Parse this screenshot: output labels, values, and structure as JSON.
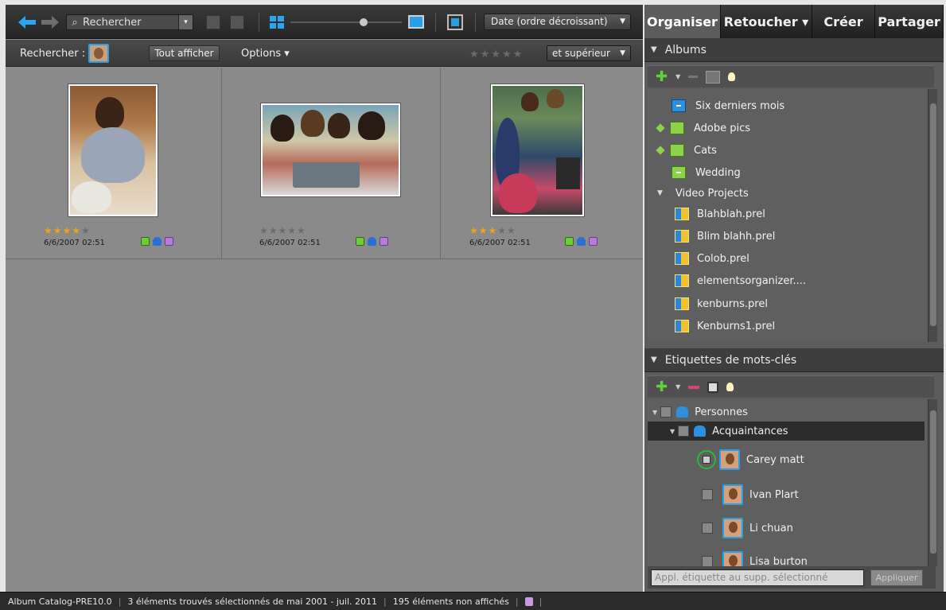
{
  "toolbar": {
    "search_placeholder": "Rechercher",
    "sort_value": "Date (ordre décroissant)"
  },
  "filterbar": {
    "search_label": "Rechercher :",
    "show_all": "Tout afficher",
    "options": "Options ▾",
    "rating_filter": "et supérieur"
  },
  "photos": [
    {
      "date": "6/6/2007 02:51",
      "rating": 4
    },
    {
      "date": "6/6/2007 02:51",
      "rating": 0
    },
    {
      "date": "6/6/2007 02:51",
      "rating": 3
    }
  ],
  "tabs": {
    "organize": "Organiser",
    "fix": "Retoucher ▾",
    "create": "Créer",
    "share": "Partager"
  },
  "albums": {
    "title": "Albums",
    "items": [
      {
        "label": "Six derniers mois",
        "icon": "album-blue-icon"
      },
      {
        "label": "Adobe pics",
        "icon": "smart-album-icon"
      },
      {
        "label": "Cats",
        "icon": "smart-album-icon"
      },
      {
        "label": "Wedding",
        "icon": "album-green-icon"
      },
      {
        "label": "Video Projects",
        "icon": "group-icon"
      },
      {
        "label": "Blahblah.prel",
        "icon": "premiere-project-icon"
      },
      {
        "label": "Blim blahh.prel",
        "icon": "premiere-project-icon"
      },
      {
        "label": "Colob.prel",
        "icon": "premiere-project-icon"
      },
      {
        "label": "elementsorganizer....",
        "icon": "premiere-project-icon"
      },
      {
        "label": "kenburns.prel",
        "icon": "premiere-project-icon"
      },
      {
        "label": "Kenburns1.prel",
        "icon": "premiere-project-icon"
      }
    ]
  },
  "keywords": {
    "title": "Etiquettes de mots-clés",
    "category": "Personnes",
    "subcategory": "Acquaintances",
    "people": [
      {
        "name": "Carey matt"
      },
      {
        "name": "Ivan Plart"
      },
      {
        "name": "Li chuan"
      },
      {
        "name": "Lisa burton"
      }
    ],
    "apply_placeholder": "Appl. étiquette au supp. sélectionné",
    "apply_button": "Appliquer"
  },
  "status": {
    "catalog": "Album Catalog-PRE10.0",
    "found": "3 éléments trouvés sélectionnés de mai 2001 - juil. 2011",
    "hidden": "195 éléments non affichés"
  },
  "colors": {
    "accent_blue": "#29a0e6",
    "star": "#f0a21a",
    "plus_green": "#5fd13a",
    "minus_red": "#e0417a"
  }
}
